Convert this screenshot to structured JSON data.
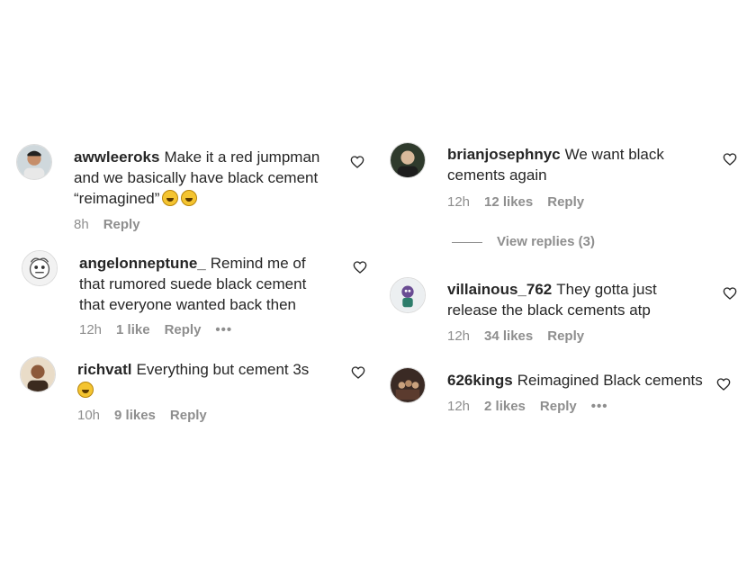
{
  "comments": [
    {
      "username": "awwleeroks",
      "text": "Make it a red jumpman and we basically have black cement “reimagined”",
      "emoji": "grinning-sweat-emoji",
      "time": "8h",
      "likes": "",
      "reply": "Reply"
    },
    {
      "username": "angelonneptune_",
      "text": "Remind me of that rumored suede black cement that everyone wanted back then",
      "time": "12h",
      "likes": "1 like",
      "reply": "Reply",
      "more": "•••"
    },
    {
      "username": "richvatl",
      "text": "Everything but cement 3s",
      "emoji": "grinning-sweat-emoji",
      "time": "10h",
      "likes": "9 likes",
      "reply": "Reply"
    },
    {
      "username": "brianjosephnyc",
      "text": "We want black cements again",
      "time": "12h",
      "likes": "12 likes",
      "reply": "Reply",
      "view_replies": "View replies (3)"
    },
    {
      "username": "villainous_762",
      "text": "They gotta just release the black cements atp",
      "time": "12h",
      "likes": "34 likes",
      "reply": "Reply"
    },
    {
      "username": "626kings",
      "text": "Reimagined Black cements",
      "time": "12h",
      "likes": "2 likes",
      "reply": "Reply",
      "more": "•••"
    }
  ],
  "icons": {
    "like": "heart-outline-icon",
    "more": "more-options-icon"
  },
  "colors": {
    "text": "#262626",
    "meta": "#8e8e8e"
  }
}
